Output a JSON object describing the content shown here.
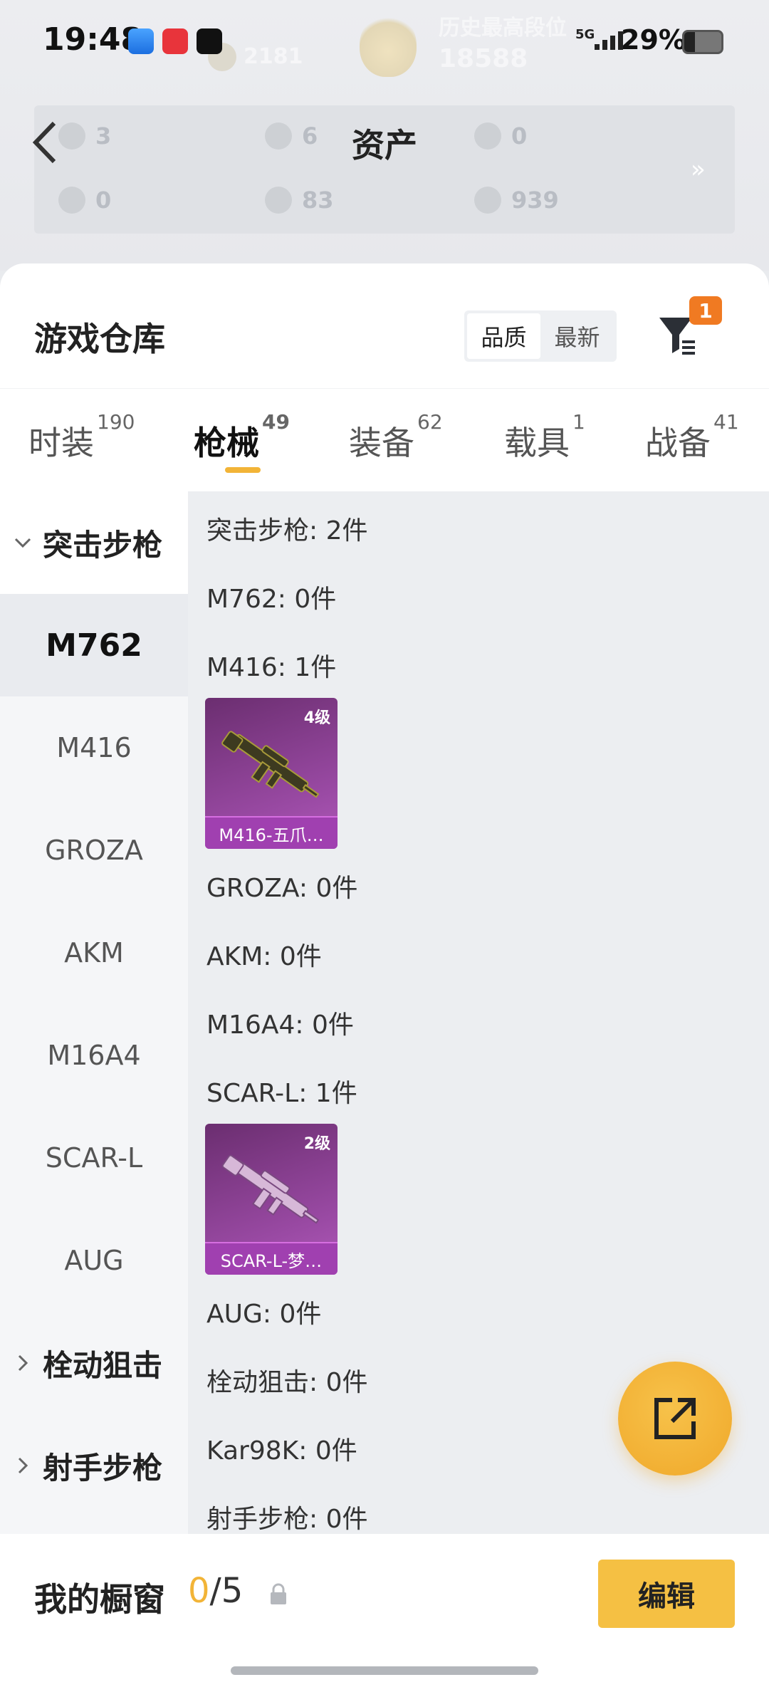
{
  "status_bar": {
    "time": "19:48",
    "network": "5G",
    "battery": "29%"
  },
  "background_profile": {
    "faded_title": "历史最高段位",
    "faded_value": "18588",
    "faded_small": "2181"
  },
  "assets": {
    "title": "资产",
    "items": [
      {
        "value": "3"
      },
      {
        "value": "6"
      },
      {
        "value": "0"
      },
      {
        "value": "0"
      },
      {
        "value": "83"
      },
      {
        "value": "939"
      }
    ]
  },
  "warehouse": {
    "title": "游戏仓库",
    "sort_options": [
      "品质",
      "最新"
    ],
    "sort_selected": "品质",
    "filter_badge": "1"
  },
  "tabs": [
    {
      "label": "时装",
      "count": "190",
      "active": false
    },
    {
      "label": "枪械",
      "count": "49",
      "active": true
    },
    {
      "label": "装备",
      "count": "62",
      "active": false
    },
    {
      "label": "载具",
      "count": "1",
      "active": false
    },
    {
      "label": "战备",
      "count": "41",
      "active": false
    }
  ],
  "categories": [
    {
      "label": "突击步枪",
      "type": "group",
      "expanded": true
    },
    {
      "label": "M762",
      "type": "item",
      "selected": true
    },
    {
      "label": "M416",
      "type": "item"
    },
    {
      "label": "GROZA",
      "type": "item"
    },
    {
      "label": "AKM",
      "type": "item"
    },
    {
      "label": "M16A4",
      "type": "item"
    },
    {
      "label": "SCAR-L",
      "type": "item"
    },
    {
      "label": "AUG",
      "type": "item"
    },
    {
      "label": "栓动狙击",
      "type": "group",
      "expanded": false
    },
    {
      "label": "射手步枪",
      "type": "group",
      "expanded": false
    }
  ],
  "content_lines": [
    "突击步枪: 2件",
    "M762: 0件",
    "M416: 1件",
    "GROZA: 0件",
    "AKM: 0件",
    "M16A4: 0件",
    "SCAR-L: 1件",
    "AUG: 0件",
    "栓动狙击: 0件",
    "Kar98K: 0件",
    "射手步枪: 0件"
  ],
  "cards": [
    {
      "level": "4级",
      "name": "M416-五爪…"
    },
    {
      "level": "2级",
      "name": "SCAR-L-梦…"
    }
  ],
  "showcase": {
    "label": "我的橱窗",
    "current": "0",
    "total": "/5",
    "edit_label": "编辑"
  },
  "colors": {
    "accent": "#f2b437",
    "badge": "#f07a22",
    "card_purple": "#9a4aa4"
  }
}
